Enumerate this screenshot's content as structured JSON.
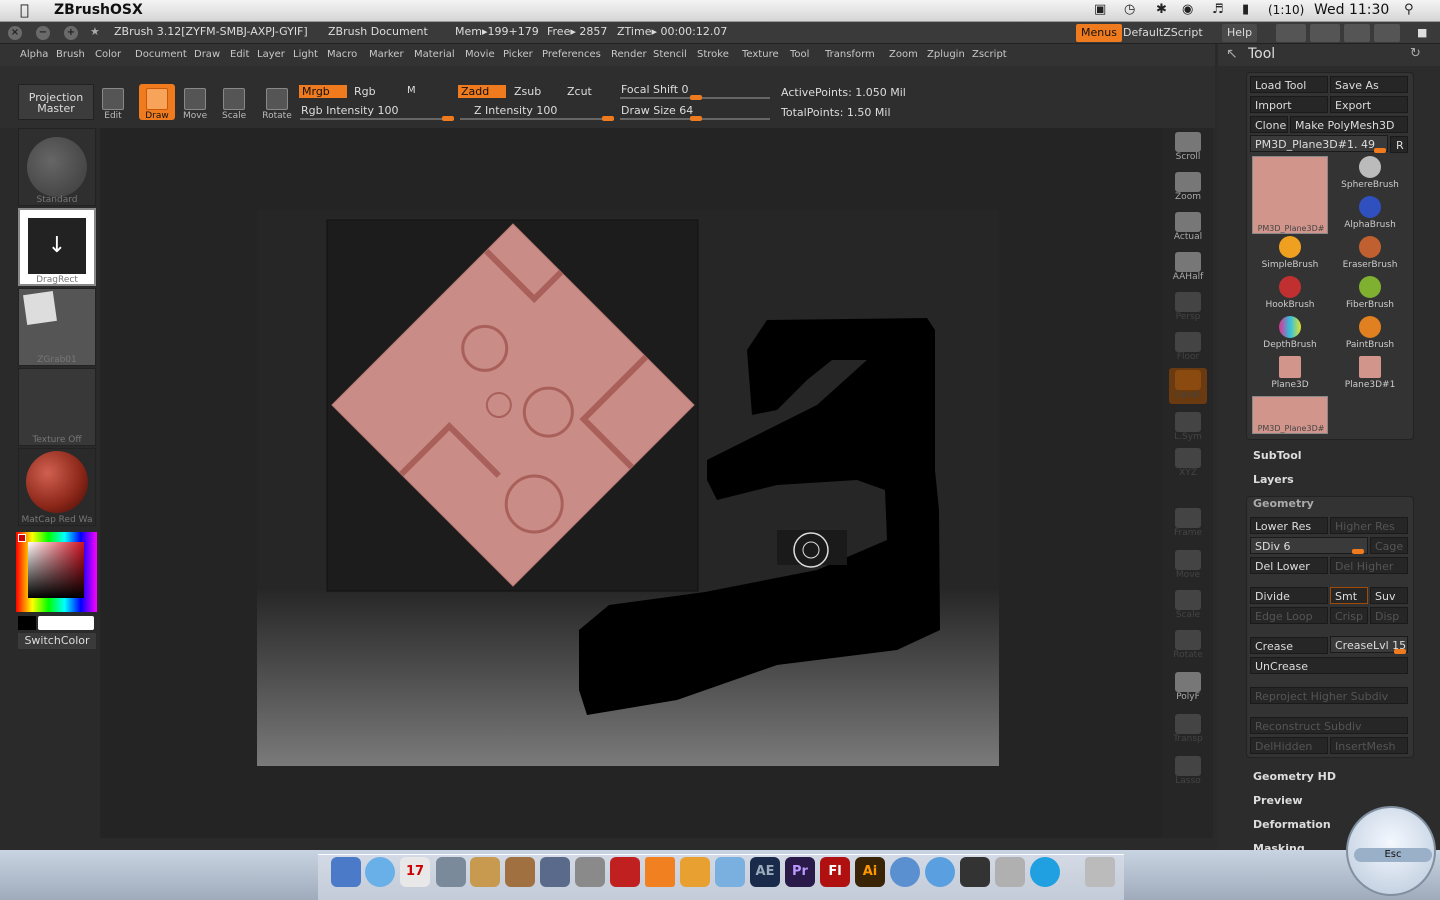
{
  "macbar": {
    "app_name": "ZBrushOSX",
    "clock": "Wed 11:30",
    "battery": "(1:10)"
  },
  "zbrush": {
    "title": "ZBrush 3.12[ZYFM-SMBJ-AXPJ-GYIF]",
    "document": "ZBrush Document",
    "mem": "Mem▸199+179",
    "free": "Free▸ 2857",
    "ztime": "ZTime▸ 00:00:12.07",
    "menus_btn": "Menus",
    "script_btn": "DefaultZScript",
    "help_btn": "Help"
  },
  "menu": [
    "Alpha",
    "Brush",
    "Color",
    "Document",
    "Draw",
    "Edit",
    "Layer",
    "Light",
    "Macro",
    "Marker",
    "Material",
    "Movie",
    "Picker",
    "Preferences",
    "Render",
    "Stencil",
    "Stroke",
    "Texture",
    "Tool",
    "Transform",
    "Zoom",
    "Zplugin",
    "Zscript"
  ],
  "shelf": {
    "projection": "Projection",
    "master": "Master",
    "tools": [
      "Edit",
      "Draw",
      "Move",
      "Scale",
      "Rotate"
    ],
    "mrgb": "Mrgb",
    "rgb": "Rgb",
    "m": "M",
    "zadd": "Zadd",
    "zsub": "Zsub",
    "zcut": "Zcut",
    "rgb_intensity": "Rgb Intensity 100",
    "z_intensity": "Z Intensity 100",
    "focal_shift": "Focal Shift 0",
    "draw_size": "Draw Size 64",
    "active_points": "ActivePoints: 1.050 Mil",
    "total_points": "TotalPoints: 1.50 Mil"
  },
  "left": {
    "standard": "Standard",
    "dragrect": "DragRect",
    "zgrab": "ZGrab01",
    "texture": "Texture Off",
    "matcap": "MatCap Red Wa",
    "switch": "SwitchColor"
  },
  "nav": [
    {
      "label": "Scroll",
      "dim": false
    },
    {
      "label": "Zoom",
      "dim": false
    },
    {
      "label": "Actual",
      "dim": false
    },
    {
      "label": "AAHalf",
      "dim": false
    },
    {
      "label": "Persp",
      "dim": true
    },
    {
      "label": "Floor",
      "dim": true
    },
    {
      "label": "Local",
      "dim": true
    },
    {
      "label": "L.Sym",
      "dim": true
    },
    {
      "label": "XYZ",
      "dim": true
    },
    {
      "label": "Frame",
      "dim": true
    },
    {
      "label": "Move",
      "dim": true
    },
    {
      "label": "Scale",
      "dim": true
    },
    {
      "label": "Rotate",
      "dim": true
    },
    {
      "label": "PolyF",
      "dim": false
    },
    {
      "label": "Transp",
      "dim": true
    },
    {
      "label": "Lasso",
      "dim": true
    }
  ],
  "tool": {
    "title": "Tool",
    "load": "Load Tool",
    "save": "Save As",
    "import": "Import",
    "export": "Export",
    "clone": "Clone",
    "make": "Make PolyMesh3D",
    "current": "PM3D_Plane3D#1. 49",
    "r": "R",
    "brushes": [
      "PM3D_Plane3D#",
      "SphereBrush",
      "AlphaBrush",
      "SimpleBrush",
      "EraserBrush",
      "HookBrush",
      "FiberBrush",
      "DepthBrush",
      "PaintBrush",
      "Plane3D",
      "Plane3D#1",
      "PM3D_Plane3D#"
    ],
    "subtool": "SubTool",
    "layers": "Layers",
    "geometry": "Geometry",
    "lower_res": "Lower Res",
    "higher_res": "Higher Res",
    "sdiv": "SDiv 6",
    "cage": "Cage",
    "del_lower": "Del Lower",
    "del_higher": "Del Higher",
    "divide": "Divide",
    "smt": "Smt",
    "suv": "Suv",
    "edge_loop": "Edge Loop",
    "crisp": "Crisp",
    "disp": "Disp",
    "crease": "Crease",
    "crease_lvl": "CreaseLvl 15",
    "uncrease": "UnCrease",
    "reproject": "Reproject Higher Subdiv",
    "reconstruct": "Reconstruct Subdiv",
    "delhidden": "DelHidden",
    "insertmesh": "InsertMesh",
    "geometry_hd": "Geometry HD",
    "preview": "Preview",
    "deformation": "Deformation",
    "masking": "Masking",
    "esc": "Esc"
  },
  "dock": [
    "AE",
    "Pr",
    "Fl",
    "Ai"
  ],
  "colors": {
    "accent": "#f07a1e",
    "panel": "#2c2c2c",
    "plane": "#c98c86"
  }
}
